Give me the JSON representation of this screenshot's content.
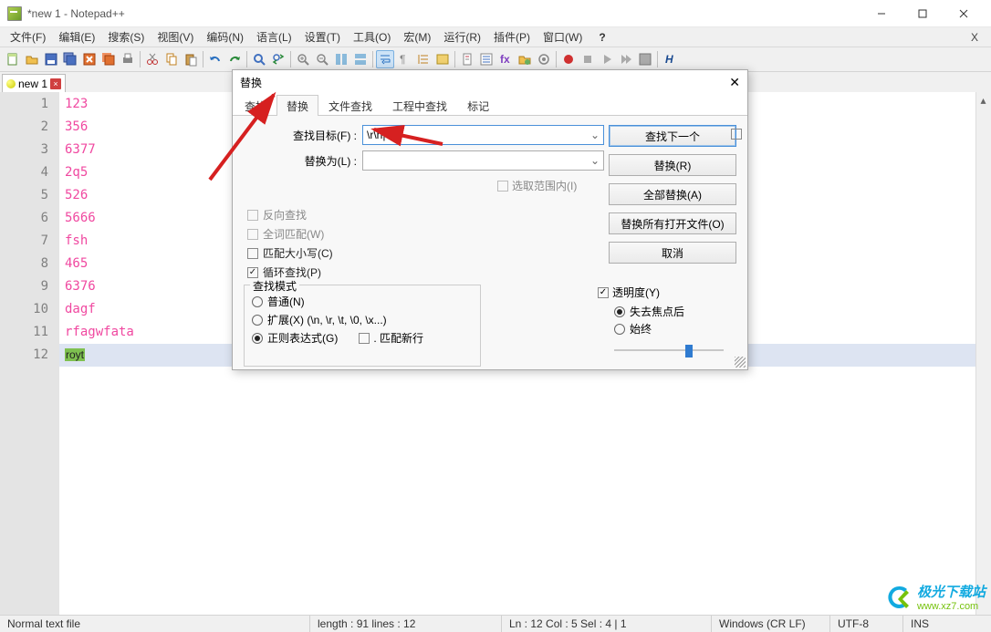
{
  "window": {
    "title": "*new 1 - Notepad++"
  },
  "menu": {
    "items": [
      "文件(F)",
      "编辑(E)",
      "搜索(S)",
      "视图(V)",
      "编码(N)",
      "语言(L)",
      "设置(T)",
      "工具(O)",
      "宏(M)",
      "运行(R)",
      "插件(P)",
      "窗口(W)"
    ],
    "help": "?",
    "close": "X"
  },
  "doctab": {
    "name": "new 1",
    "close": "×"
  },
  "code": {
    "lines": [
      "123",
      "356",
      "6377",
      "2q5",
      "526",
      "5666",
      "fsh",
      "465",
      "6376",
      "dagf",
      "rfagwfata"
    ],
    "lastline_hilite": "royt"
  },
  "dialog": {
    "title": "替换",
    "close": "✕",
    "tabs": [
      "查找",
      "替换",
      "文件查找",
      "工程中查找",
      "标记"
    ],
    "active_tab": 1,
    "find_label": "查找目标(F) :",
    "find_value": "\\r\\n|",
    "replace_label": "替换为(L) :",
    "replace_value": "",
    "in_selection": "选取范围内(I)",
    "opts": {
      "backward": "反向查找",
      "wholeword": "全词匹配(W)",
      "matchcase": "匹配大小写(C)",
      "wrap": "循环查找(P)"
    },
    "mode": {
      "legend": "查找模式",
      "normal": "普通(N)",
      "extended": "扩展(X) (\\n, \\r, \\t, \\0, \\x...)",
      "regex": "正则表达式(G)",
      "matchnew": ". 匹配新行"
    },
    "trans": {
      "label": "透明度(Y)",
      "onlose": "失去焦点后",
      "always": "始终"
    },
    "buttons": {
      "findnext": "查找下一个",
      "replace": "替换(R)",
      "replaceall": "全部替换(A)",
      "replaceallopen": "替换所有打开文件(O)",
      "cancel": "取消"
    }
  },
  "status": {
    "filetype": "Normal text file",
    "length": "length : 91    lines : 12",
    "pos": "Ln : 12    Col : 5    Sel : 4 | 1",
    "eol": "Windows (CR LF)",
    "enc": "UTF-8",
    "ins": "INS"
  },
  "watermark": {
    "brand": "极光下载站",
    "url": "www.xz7.com"
  }
}
